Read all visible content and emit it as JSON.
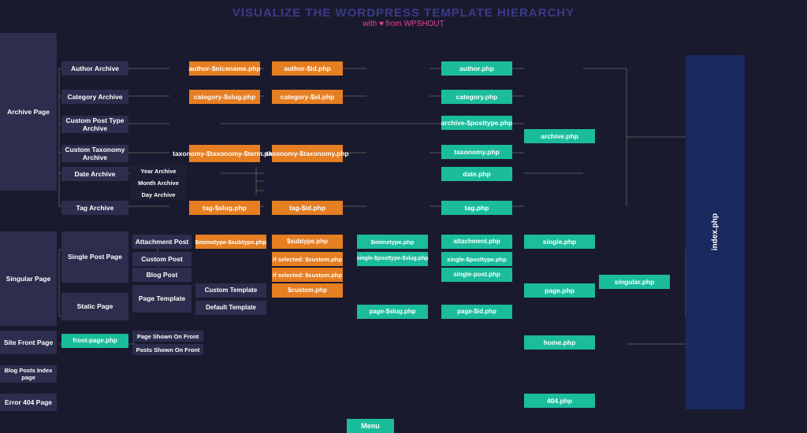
{
  "title": {
    "main": "VISUALIZE THE WORDPRESS TEMPLATE HIERARCHY",
    "sub": "with ♥ from WPSHOUT"
  },
  "nodes": {
    "archive_page": "Archive Page",
    "author_archive": "Author Archive",
    "category_archive": "Category Archive",
    "custom_post_type_archive": "Custom Post Type Archive",
    "custom_taxonomy_archive": "Custom Taxonomy Archive",
    "date_archive": "Date Archive",
    "tag_archive": "Tag Archive",
    "year_archive": "Year Archive",
    "month_archive": "Month Archive",
    "day_archive": "Day Archive",
    "author_nicename": "author-$nicename.php",
    "author_id": "author-$id.php",
    "category_slug": "category-$slug.php",
    "category_id": "category-$id.php",
    "taxonomy_term": "taxonomy-$taxonomy-$term.php",
    "taxonomy_php": "taxonomy-$taxonomy.php",
    "tag_slug": "tag-$slug.php",
    "tag_id": "tag-$id.php",
    "author_php": "author.php",
    "category_php": "category.php",
    "archive_posttype": "archive-$posttype.php",
    "taxonomy_php2": "taxonomy.php",
    "date_php": "date.php",
    "tag_php": "tag.php",
    "archive_php": "archive.php",
    "index_php": "index.php",
    "singular_page": "Singular Page",
    "single_post_page": "Single Post Page",
    "attachment_post": "Attachment Post",
    "custom_post": "Custom Post",
    "blog_post": "Blog Post",
    "static_page": "Static Page",
    "page_template": "Page Template",
    "custom_template": "Custom Template",
    "default_template": "Default Template",
    "mimetype_subtype": "$mimetype-$subtype.php",
    "subtype_php": "$subtype.php",
    "if_selected_custom": "if selected: $custom.php",
    "if_selected_custom2": "if selected: $custom.php",
    "custom_php": "$custom.php",
    "mimetype_php": "$mimetype.php",
    "single_posttype_slug": "single-$posttype-$slug.php",
    "single_posttype": "single-$posttype.php",
    "single_post": "single-post.php",
    "attachment_php": "attachment.php",
    "page_slug": "page-$slug.php",
    "page_id": "page-$id.php",
    "page_php": "page.php",
    "single_php": "single.php",
    "singular_php": "singular.php",
    "site_front_page": "Site Front Page",
    "front_page_php": "front-page.php",
    "page_shown_on_front": "Page Shown On Front",
    "posts_shown_on_front": "Posts Shown On Front",
    "home_php": "home.php",
    "blog_posts_index": "Blog Posts Index page",
    "error_404": "Error 404 Page",
    "error_404_php": "404.php",
    "menu": "Menu"
  },
  "colors": {
    "orange": "#e67e22",
    "red": "#e74c3c",
    "teal": "#1abc9c",
    "dark": "#2d2d4e",
    "navy": "#2c3e7a",
    "darknavy": "#1e2a5e",
    "connector": "#555577"
  }
}
